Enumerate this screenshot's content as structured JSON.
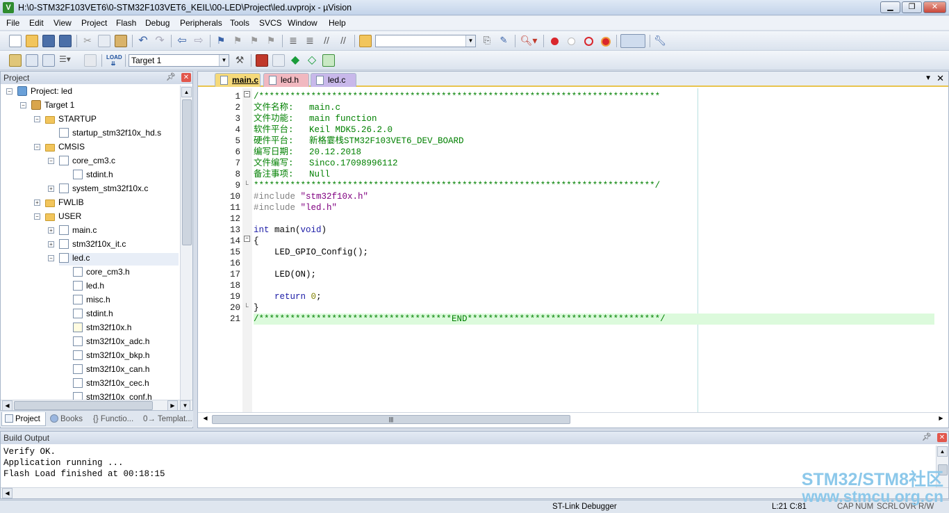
{
  "window": {
    "title": "H:\\0-STM32F103VET6\\0-STM32F103VET6_KEIL\\00-LED\\Project\\led.uvprojx - µVision",
    "icon": "uvision-app-icon"
  },
  "menu": [
    "File",
    "Edit",
    "View",
    "Project",
    "Flash",
    "Debug",
    "Peripherals",
    "Tools",
    "SVCS",
    "Window",
    "Help"
  ],
  "toolbar": {
    "find_combo_value": "",
    "target_combo_value": "Target 1"
  },
  "project_panel": {
    "title": "Project",
    "tree": [
      {
        "label": "Project: led",
        "icon": "project-icon"
      },
      {
        "label": "Target 1",
        "icon": "target-icon"
      },
      {
        "label": "STARTUP",
        "icon": "folder-icon"
      },
      {
        "label": "startup_stm32f10x_hd.s",
        "icon": "file-icon"
      },
      {
        "label": "CMSIS",
        "icon": "folder-icon"
      },
      {
        "label": "core_cm3.c",
        "icon": "file-icon"
      },
      {
        "label": "stdint.h",
        "icon": "file-icon"
      },
      {
        "label": "system_stm32f10x.c",
        "icon": "file-icon"
      },
      {
        "label": "FWLIB",
        "icon": "folder-icon"
      },
      {
        "label": "USER",
        "icon": "folder-icon"
      },
      {
        "label": "main.c",
        "icon": "file-icon"
      },
      {
        "label": "stm32f10x_it.c",
        "icon": "file-icon"
      },
      {
        "label": "led.c",
        "icon": "file-icon"
      },
      {
        "label": "core_cm3.h",
        "icon": "file-icon"
      },
      {
        "label": "led.h",
        "icon": "file-icon"
      },
      {
        "label": "misc.h",
        "icon": "file-icon"
      },
      {
        "label": "stdint.h",
        "icon": "file-icon"
      },
      {
        "label": "stm32f10x.h",
        "icon": "file-icon"
      },
      {
        "label": "stm32f10x_adc.h",
        "icon": "file-icon"
      },
      {
        "label": "stm32f10x_bkp.h",
        "icon": "file-icon"
      },
      {
        "label": "stm32f10x_can.h",
        "icon": "file-icon"
      },
      {
        "label": "stm32f10x_cec.h",
        "icon": "file-icon"
      },
      {
        "label": "stm32f10x_conf.h",
        "icon": "file-icon"
      }
    ],
    "bottom_tabs": [
      "Project",
      "Books",
      "{} Functio...",
      "0→ Templat..."
    ]
  },
  "editor": {
    "tabs": [
      {
        "label": "main.c",
        "active": true,
        "color": "#f5d97a"
      },
      {
        "label": "led.h",
        "active": false,
        "color": "#f1b8c0"
      },
      {
        "label": "led.c",
        "active": false,
        "color": "#c8b8ea"
      }
    ],
    "lines": [
      "/*****************************************************************************",
      "文件名称:   main.c",
      "文件功能:   main function",
      "软件平台:   Keil MDK5.26.2.0",
      "硬件平台:   新格霎栈STM32F103VET6_DEV_BOARD",
      "编写日期:   20.12.2018",
      "文件编写:   Sinco.17098996112",
      "备注事项:   Null",
      "*****************************************************************************/",
      "#include \"stm32f10x.h\"",
      "#include \"led.h\"",
      "",
      "int main(void)",
      "{",
      "    LED_GPIO_Config();",
      "",
      "    LED(ON);",
      "",
      "    return 0;",
      "}",
      "/*************************************END*************************************/"
    ]
  },
  "build_output": {
    "title": "Build Output",
    "lines": [
      "Verify OK.",
      "Application running ...",
      "Flash Load finished at 00:18:15"
    ]
  },
  "statusbar": {
    "debugger": "ST-Link Debugger",
    "position": "L:21 C:81",
    "cap": "CAP",
    "num": "NUM",
    "scrl": "SCRL",
    "ovr": "OVR",
    "rw": "R/W"
  },
  "watermark": {
    "line1": "STM32/STM8社区",
    "line2": "www.stmcu.org.cn"
  },
  "colors": {
    "accent_tab": "#e8c44d",
    "comment": "#008000",
    "keyword": "#1a1aa6",
    "highlight_line": "#dcfadc"
  }
}
